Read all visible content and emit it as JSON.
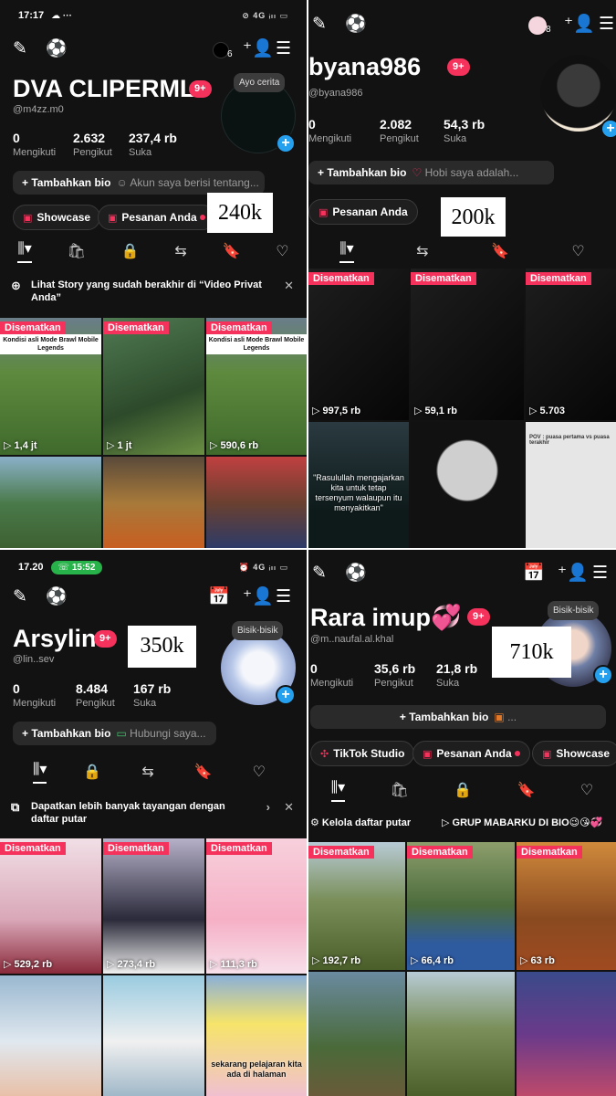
{
  "p1": {
    "status": {
      "time": "17:17",
      "icons": "☁ ···",
      "right": "⊘ 4G ᵢₗₗ ▭"
    },
    "name": "DVA CLIPERML",
    "badge": "9+",
    "handle": "@m4zz.m0",
    "notif_count": "6",
    "stats": [
      {
        "num": "0",
        "label": "Mengikuti"
      },
      {
        "num": "2.632",
        "label": "Pengikut"
      },
      {
        "num": "237,4 rb",
        "label": "Suka"
      }
    ],
    "bubble": "Ayo cerita",
    "bio_add": "Tambahkan bio",
    "bio_hint": "Akun saya berisi tentang...",
    "pills": [
      "Showcase",
      "Pesanan Anda"
    ],
    "overlay_label": "240k",
    "banner": "Lihat Story yang sudah berakhir di “Video Privat Anda”",
    "tiles": [
      {
        "pinned": "Disematkan",
        "caption": "Kondisi asli Mode Brawl Mobile Legends",
        "views": "1,4 jt"
      },
      {
        "pinned": "Disematkan",
        "caption": "",
        "views": "1 jt"
      },
      {
        "pinned": "Disematkan",
        "caption": "Kondisi asli Mode Brawl Mobile Legends",
        "views": "590,6 rb"
      },
      {
        "pinned": "",
        "caption": "",
        "views": ""
      },
      {
        "pinned": "",
        "caption": "",
        "views": ""
      },
      {
        "pinned": "",
        "caption": "",
        "views": ""
      }
    ]
  },
  "p2": {
    "name": "byana986",
    "badge": "9+",
    "handle": "@byana986",
    "notif_count": "8",
    "stats": [
      {
        "num": "0",
        "label": "Mengikuti"
      },
      {
        "num": "2.082",
        "label": "Pengikut"
      },
      {
        "num": "54,3 rb",
        "label": "Suka"
      }
    ],
    "bio_add": "Tambahkan bio",
    "bio_hint": "Hobi saya adalah...",
    "pills": [
      "Pesanan Anda"
    ],
    "overlay_label": "200k",
    "tiles": [
      {
        "pinned": "Disematkan",
        "caption": "",
        "views": "997,5 rb"
      },
      {
        "pinned": "Disematkan",
        "caption": "",
        "views": "59,1 rb"
      },
      {
        "pinned": "Disematkan",
        "caption": "",
        "views": "5.703"
      },
      {
        "pinned": "",
        "caption": "\"Rasulullah mengajarkan kita untuk tetap tersenyum walaupun itu menyakitkan\"",
        "views": ""
      },
      {
        "pinned": "",
        "caption": "",
        "views": ""
      },
      {
        "pinned": "",
        "caption": "POV : puasa pertama vs puasa terakhir",
        "views": ""
      }
    ]
  },
  "p3": {
    "status": {
      "time": "17.20",
      "call": "15:52",
      "right": "⏰ 4G ᵢₗₗ ▭"
    },
    "name": "Arsylin",
    "badge": "9+",
    "handle": "@lin..sev",
    "stats": [
      {
        "num": "0",
        "label": "Mengikuti"
      },
      {
        "num": "8.484",
        "label": "Pengikut"
      },
      {
        "num": "167 rb",
        "label": "Suka"
      }
    ],
    "bubble": "Bisik-bisik",
    "bio_add": "Tambahkan bio",
    "bio_hint": "Hubungi saya...",
    "overlay_label": "350k",
    "banner": "Dapatkan lebih banyak tayangan dengan daftar putar",
    "tiles": [
      {
        "pinned": "Disematkan",
        "caption": "",
        "views": "529,2 rb"
      },
      {
        "pinned": "Disematkan",
        "caption": "",
        "views": "273,4 rb"
      },
      {
        "pinned": "Disematkan",
        "caption": "",
        "views": "111,3 rb"
      },
      {
        "pinned": "",
        "caption": "",
        "views": ""
      },
      {
        "pinned": "",
        "caption": "",
        "views": ""
      },
      {
        "pinned": "",
        "caption": "sekarang pelajaran kita ada di halaman",
        "views": ""
      }
    ]
  },
  "p4": {
    "name": "Rara imup💞",
    "badge": "9+",
    "handle": "@m..naufal.al.khal",
    "stats": [
      {
        "num": "0",
        "label": "Mengikuti"
      },
      {
        "num": "35,6 rb",
        "label": "Pengikut"
      },
      {
        "num": "21,8 rb",
        "label": "Suka"
      }
    ],
    "bubble": "Bisik-bisik",
    "bio_add": "Tambahkan bio",
    "bio_hint": "...",
    "pills": [
      "TikTok Studio",
      "Pesanan Anda",
      "Showcase"
    ],
    "overlay_label": "710k",
    "playlists": [
      "Kelola daftar putar",
      "GRUP MABARKU DI BIO😉😘💞"
    ],
    "tiles": [
      {
        "pinned": "Disematkan",
        "caption": "",
        "views": "192,7 rb"
      },
      {
        "pinned": "Disematkan",
        "caption": "",
        "views": "66,4 rb"
      },
      {
        "pinned": "Disematkan",
        "caption": "",
        "views": "63 rb"
      },
      {
        "pinned": "",
        "caption": "",
        "views": ""
      },
      {
        "pinned": "",
        "caption": "",
        "views": ""
      },
      {
        "pinned": "",
        "caption": "",
        "views": ""
      }
    ]
  },
  "colors": {
    "accent": "#f5325c",
    "background": "#121212",
    "blue": "#25a0ee"
  }
}
